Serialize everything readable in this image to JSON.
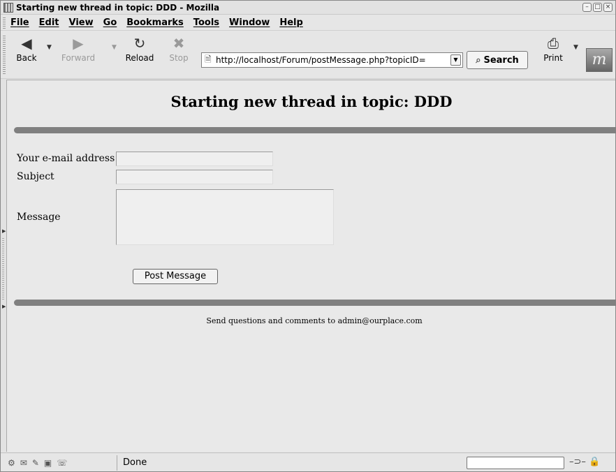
{
  "window": {
    "title": "Starting new thread in topic: DDD - Mozilla",
    "controls": [
      "minimize",
      "maximize",
      "close"
    ]
  },
  "menubar": {
    "items": [
      {
        "u": "F",
        "rest": "ile"
      },
      {
        "u": "E",
        "rest": "dit"
      },
      {
        "u": "V",
        "rest": "iew"
      },
      {
        "u": "G",
        "rest": "o"
      },
      {
        "u": "B",
        "rest": "ookmarks"
      },
      {
        "u": "T",
        "rest": "ools"
      },
      {
        "u": "W",
        "rest": "indow"
      },
      {
        "u": "H",
        "rest": "elp"
      }
    ]
  },
  "toolbar": {
    "back": {
      "label": "Back",
      "icon": "back-arrow-icon"
    },
    "forward": {
      "label": "Forward",
      "icon": "forward-arrow-icon"
    },
    "reload": {
      "label": "Reload",
      "icon": "reload-icon"
    },
    "stop": {
      "label": "Stop",
      "icon": "stop-icon"
    },
    "url": "http://localhost/Forum/postMessage.php?topicID=",
    "search_label": "Search",
    "print": {
      "label": "Print",
      "icon": "printer-icon"
    }
  },
  "page": {
    "title": "Starting new thread in topic: DDD",
    "form": {
      "email_label": "Your e-mail address",
      "email_value": "",
      "subject_label": "Subject",
      "subject_value": "",
      "message_label": "Message",
      "message_value": "",
      "submit_label": "Post Message"
    },
    "footer": "Send questions and comments to admin@ourplace.com"
  },
  "statusbar": {
    "text": "Done"
  },
  "colors": {
    "rule": "#808080",
    "background": "#e9e9e9"
  }
}
